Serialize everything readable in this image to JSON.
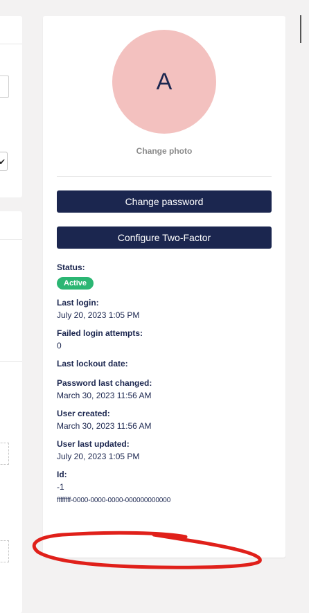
{
  "profile": {
    "avatar_initial": "A",
    "change_photo_label": "Change photo"
  },
  "actions": {
    "change_password_label": "Change password",
    "configure_two_factor_label": "Configure Two-Factor"
  },
  "details": {
    "status_label": "Status:",
    "status_value": "Active",
    "last_login_label": "Last login:",
    "last_login_value": "July 20, 2023 1:05 PM",
    "failed_attempts_label": "Failed login attempts:",
    "failed_attempts_value": "0",
    "last_lockout_label": "Last lockout date:",
    "password_changed_label": "Password last changed:",
    "password_changed_value": "March 30, 2023 11:56 AM",
    "user_created_label": "User created:",
    "user_created_value": "March 30, 2023 11:56 AM",
    "user_updated_label": "User last updated:",
    "user_updated_value": "July 20, 2023 1:05 PM",
    "id_label": "Id:",
    "id_value": "-1",
    "guid_value": "ffffffff-0000-0000-0000-000000000000"
  },
  "colors": {
    "primary": "#1b264f",
    "avatar_bg": "#f3c1bf",
    "status_active": "#2bb673",
    "annotation": "#e0201a"
  }
}
